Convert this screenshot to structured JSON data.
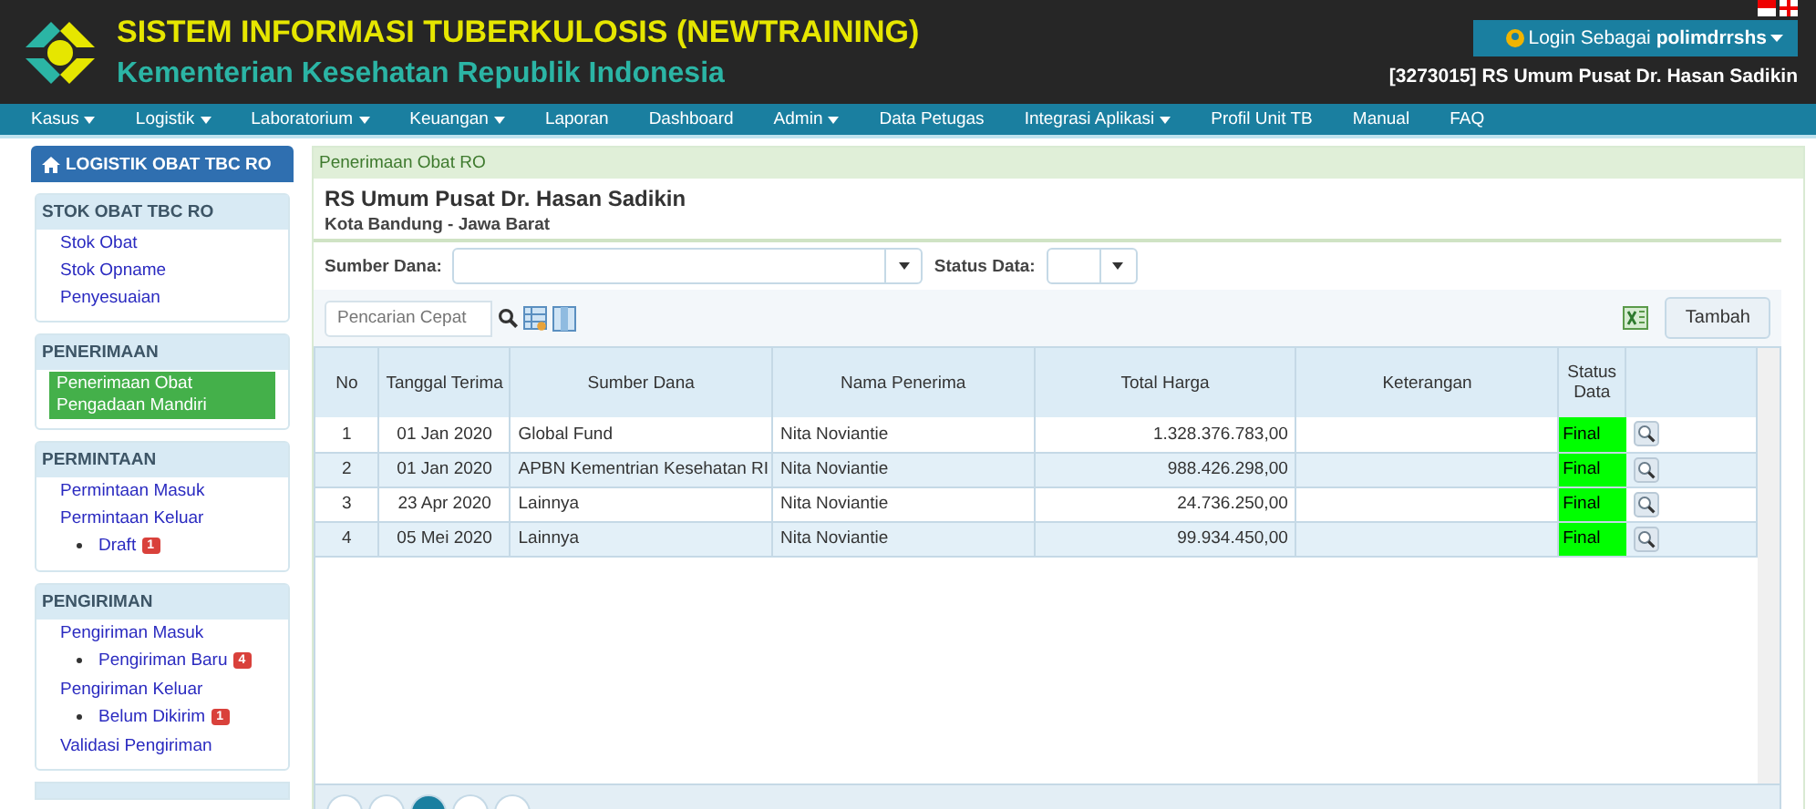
{
  "header": {
    "title": "SISTEM INFORMASI TUBERKULOSIS (NEWTRAINING)",
    "subtitle": "Kementerian Kesehatan Republik Indonesia",
    "login": "Login Sebagai **polimdrrshs**",
    "unit": "[3273015] RS Umum Pusat Dr. Hasan Sadikin"
  },
  "nav": [
    {
      "label": "Kasus",
      "dropdown": true
    },
    {
      "label": "Logistik",
      "dropdown": true
    },
    {
      "label": "Laboratorium",
      "dropdown": true
    },
    {
      "label": "Keuangan",
      "dropdown": true
    },
    {
      "label": "Laporan",
      "dropdown": false
    },
    {
      "label": "Dashboard",
      "dropdown": false
    },
    {
      "label": "Admin",
      "dropdown": true
    },
    {
      "label": "Data Petugas",
      "dropdown": false
    },
    {
      "label": "Integrasi Aplikasi",
      "dropdown": true
    },
    {
      "label": "Profil Unit TB",
      "dropdown": false
    },
    {
      "label": "Manual",
      "dropdown": false
    },
    {
      "label": "FAQ",
      "dropdown": false
    }
  ],
  "sidebar": {
    "title": "LOGISTIK OBAT TBC RO",
    "sections": [
      {
        "title": "STOK OBAT TBC RO",
        "items": [
          {
            "label": "Stok Obat",
            "selected": false
          },
          {
            "label": "Stok Opname",
            "selected": false
          },
          {
            "label": "Penyesuaian",
            "selected": false
          }
        ]
      },
      {
        "title": "PENERIMAAN",
        "items": [
          {
            "label": "Penerimaan Obat Pengadaan Mandiri",
            "selected": true
          }
        ]
      },
      {
        "title": "PERMINTAAN",
        "items": [
          {
            "label": "Permintaan Masuk",
            "selected": false
          },
          {
            "label": "Permintaan Keluar",
            "selected": false,
            "children": [
              {
                "label": "Draft",
                "badge": "1"
              }
            ]
          }
        ]
      },
      {
        "title": "PENGIRIMAN",
        "items": [
          {
            "label": "Pengiriman Masuk",
            "selected": false,
            "children": [
              {
                "label": "Pengiriman Baru",
                "badge": "4"
              }
            ]
          },
          {
            "label": "Pengiriman Keluar",
            "selected": false,
            "children": [
              {
                "label": "Belum Dikirim",
                "badge": "1"
              }
            ]
          },
          {
            "label": "Validasi Pengiriman",
            "selected": false
          }
        ]
      }
    ]
  },
  "breadcrumb": "Penerimaan Obat RO",
  "facility": {
    "name": "RS Umum Pusat Dr. Hasan Sadikin",
    "location": "Kota Bandung - Jawa Barat"
  },
  "filters": [
    {
      "label": "Sumber Dana:"
    },
    {
      "label": "Status Data:"
    }
  ],
  "search": {
    "placeholder": "Pencarian Cepat"
  },
  "add_button": "Tambah",
  "table": {
    "columns": [
      "No",
      "Tanggal Terima",
      "Sumber Dana",
      "Nama Penerima",
      "Total Harga",
      "Keterangan",
      "Status Data"
    ],
    "rows": [
      {
        "no": "1",
        "date": "01 Jan 2020",
        "source": "Global Fund",
        "receiver": "Nita Noviantie",
        "total": "1.328.376.783,00",
        "status": "Final"
      },
      {
        "no": "2",
        "date": "01 Jan 2020",
        "source": "APBN Kementrian Kesehatan RI",
        "receiver": "Nita Noviantie",
        "total": "988.426.298,00",
        "status": "Final"
      },
      {
        "no": "3",
        "date": "23 Apr 2020",
        "source": "Lainnya",
        "receiver": "Nita Noviantie",
        "total": "24.736.250,00",
        "status": "Final"
      },
      {
        "no": "4",
        "date": "05 Mei 2020",
        "source": "Lainnya",
        "receiver": "Nita Noviantie",
        "total": "99.934.450,00",
        "status": "Final"
      }
    ]
  }
}
